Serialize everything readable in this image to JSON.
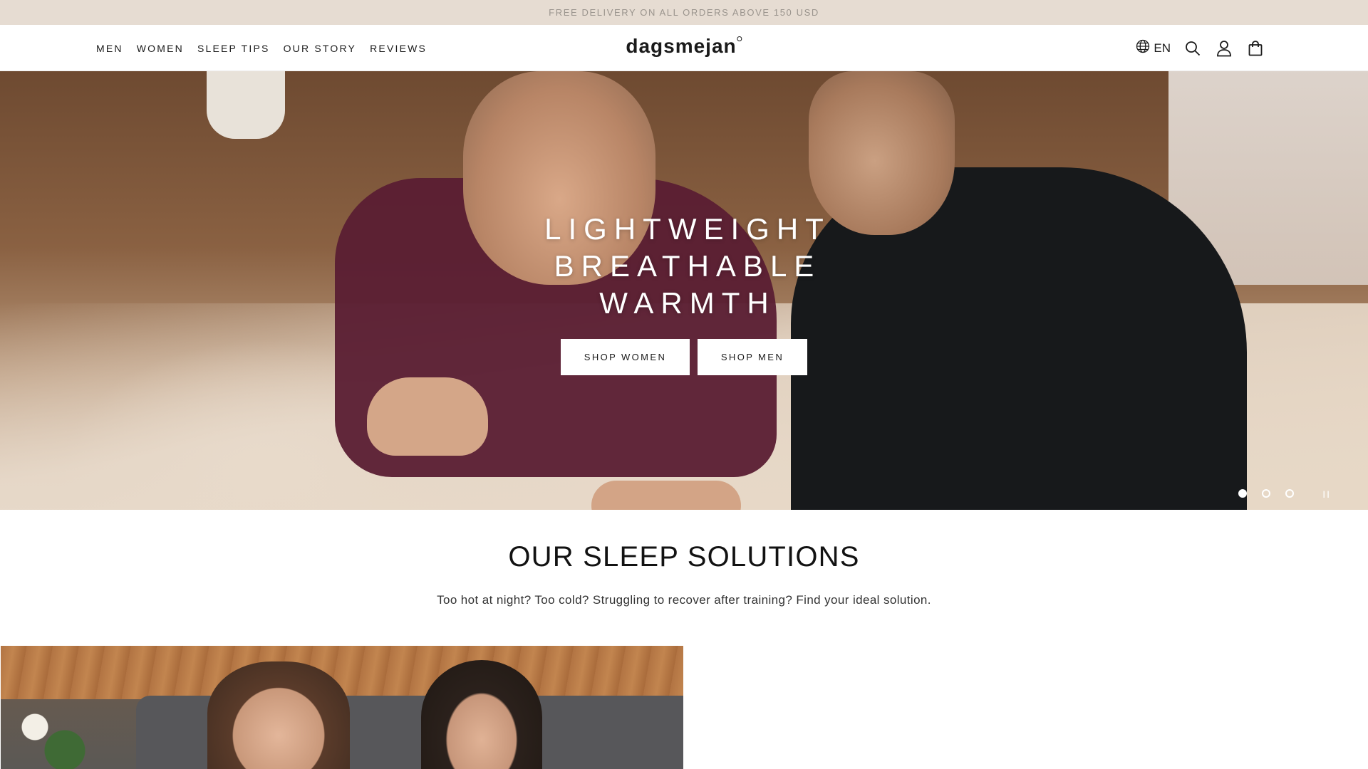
{
  "announcement": {
    "text": "FREE DELIVERY ON ALL ORDERS ABOVE 150 USD"
  },
  "header": {
    "nav": [
      {
        "label": "MEN"
      },
      {
        "label": "WOMEN"
      },
      {
        "label": "SLEEP TIPS"
      },
      {
        "label": "OUR STORY"
      },
      {
        "label": "REVIEWS"
      }
    ],
    "logo": "dagsmejan",
    "language": "EN",
    "icons": [
      "globe-icon",
      "search-icon",
      "account-icon",
      "cart-icon"
    ]
  },
  "hero": {
    "title_lines": [
      "LIGHTWEIGHT",
      "BREATHABLE",
      "WARMTH"
    ],
    "buttons": {
      "shop_women": "SHOP WOMEN",
      "shop_men": "SHOP MEN"
    },
    "slides": {
      "count": 3,
      "active": 1
    },
    "pause_label": "II"
  },
  "solutions": {
    "title": "OUR SLEEP SOLUTIONS",
    "subtitle": "Too hot at night? Too cold? Struggling to recover after training? Find your ideal solution."
  },
  "colors": {
    "announcement_bg": "#e6dcd2",
    "text": "#1a1a1a",
    "button_bg": "#ffffff"
  }
}
